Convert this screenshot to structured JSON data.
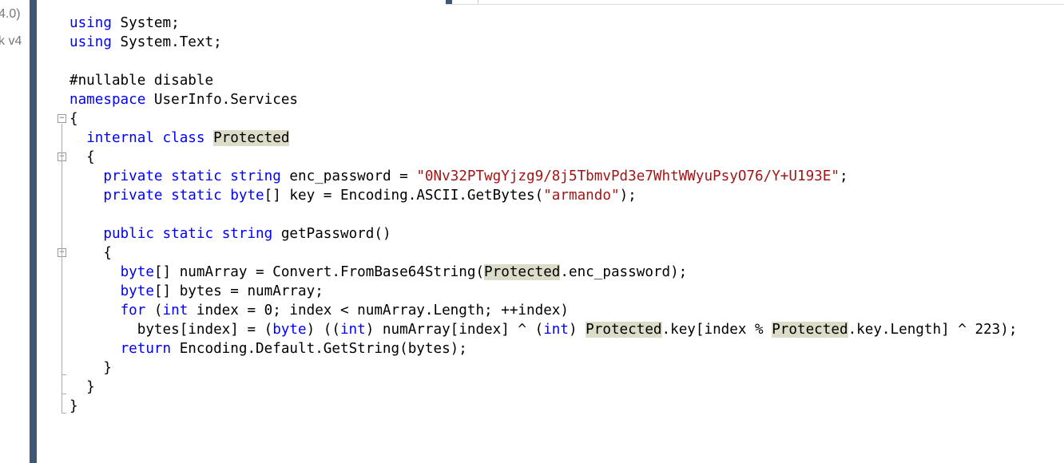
{
  "side_panel": {
    "line1": "4.0)",
    "line2": "k v4"
  },
  "editor": {
    "colors": {
      "keyword": "#0000ff",
      "string": "#a31515",
      "highlight": "#dcdcc8"
    },
    "lines": [
      [
        {
          "t": "using",
          "c": "kw"
        },
        {
          "t": " System;"
        }
      ],
      [
        {
          "t": "using",
          "c": "kw"
        },
        {
          "t": " System.Text;"
        }
      ],
      [],
      [
        {
          "t": "#nullable disable"
        }
      ],
      [
        {
          "t": "namespace",
          "c": "kw"
        },
        {
          "t": " UserInfo.Services"
        }
      ],
      [
        {
          "t": "{"
        }
      ],
      [
        {
          "t": "  "
        },
        {
          "t": "internal",
          "c": "kw"
        },
        {
          "t": " "
        },
        {
          "t": "class",
          "c": "kw"
        },
        {
          "t": " "
        },
        {
          "t": "Protected",
          "c": "hl"
        }
      ],
      [
        {
          "t": "  {"
        }
      ],
      [
        {
          "t": "    "
        },
        {
          "t": "private",
          "c": "kw"
        },
        {
          "t": " "
        },
        {
          "t": "static",
          "c": "kw"
        },
        {
          "t": " "
        },
        {
          "t": "string",
          "c": "kw"
        },
        {
          "t": " enc_password = "
        },
        {
          "t": "\"0Nv32PTwgYjzg9/8j5TbmvPd3e7WhtWWyuPsyO76/Y+U193E\"",
          "c": "str"
        },
        {
          "t": ";"
        }
      ],
      [
        {
          "t": "    "
        },
        {
          "t": "private",
          "c": "kw"
        },
        {
          "t": " "
        },
        {
          "t": "static",
          "c": "kw"
        },
        {
          "t": " "
        },
        {
          "t": "byte",
          "c": "kw"
        },
        {
          "t": "[] key = Encoding.ASCII.GetBytes("
        },
        {
          "t": "\"armando\"",
          "c": "str"
        },
        {
          "t": ");"
        }
      ],
      [],
      [
        {
          "t": "    "
        },
        {
          "t": "public",
          "c": "kw"
        },
        {
          "t": " "
        },
        {
          "t": "static",
          "c": "kw"
        },
        {
          "t": " "
        },
        {
          "t": "string",
          "c": "kw"
        },
        {
          "t": " getPassword()"
        }
      ],
      [
        {
          "t": "    {"
        }
      ],
      [
        {
          "t": "      "
        },
        {
          "t": "byte",
          "c": "kw"
        },
        {
          "t": "[] numArray = Convert.FromBase64String("
        },
        {
          "t": "Protected",
          "c": "hl"
        },
        {
          "t": ".enc_password);"
        }
      ],
      [
        {
          "t": "      "
        },
        {
          "t": "byte",
          "c": "kw"
        },
        {
          "t": "[] bytes = numArray;"
        }
      ],
      [
        {
          "t": "      "
        },
        {
          "t": "for",
          "c": "kw"
        },
        {
          "t": " ("
        },
        {
          "t": "int",
          "c": "kw"
        },
        {
          "t": " index = 0; index < numArray.Length; ++index)"
        }
      ],
      [
        {
          "t": "        bytes[index] = ("
        },
        {
          "t": "byte",
          "c": "kw"
        },
        {
          "t": ") (("
        },
        {
          "t": "int",
          "c": "kw"
        },
        {
          "t": ") numArray[index] ^ ("
        },
        {
          "t": "int",
          "c": "kw"
        },
        {
          "t": ") "
        },
        {
          "t": "Protected",
          "c": "hl"
        },
        {
          "t": ".key[index % "
        },
        {
          "t": "Protected",
          "c": "hl"
        },
        {
          "t": ".key.Length] ^ 223);"
        }
      ],
      [
        {
          "t": "      "
        },
        {
          "t": "return",
          "c": "kw"
        },
        {
          "t": " Encoding.Default.GetString(bytes);"
        }
      ],
      [
        {
          "t": "    }"
        }
      ],
      [
        {
          "t": "  }"
        }
      ],
      [
        {
          "t": "}"
        }
      ]
    ],
    "fold_markers": [
      "collapse",
      "collapse",
      "collapse"
    ]
  }
}
